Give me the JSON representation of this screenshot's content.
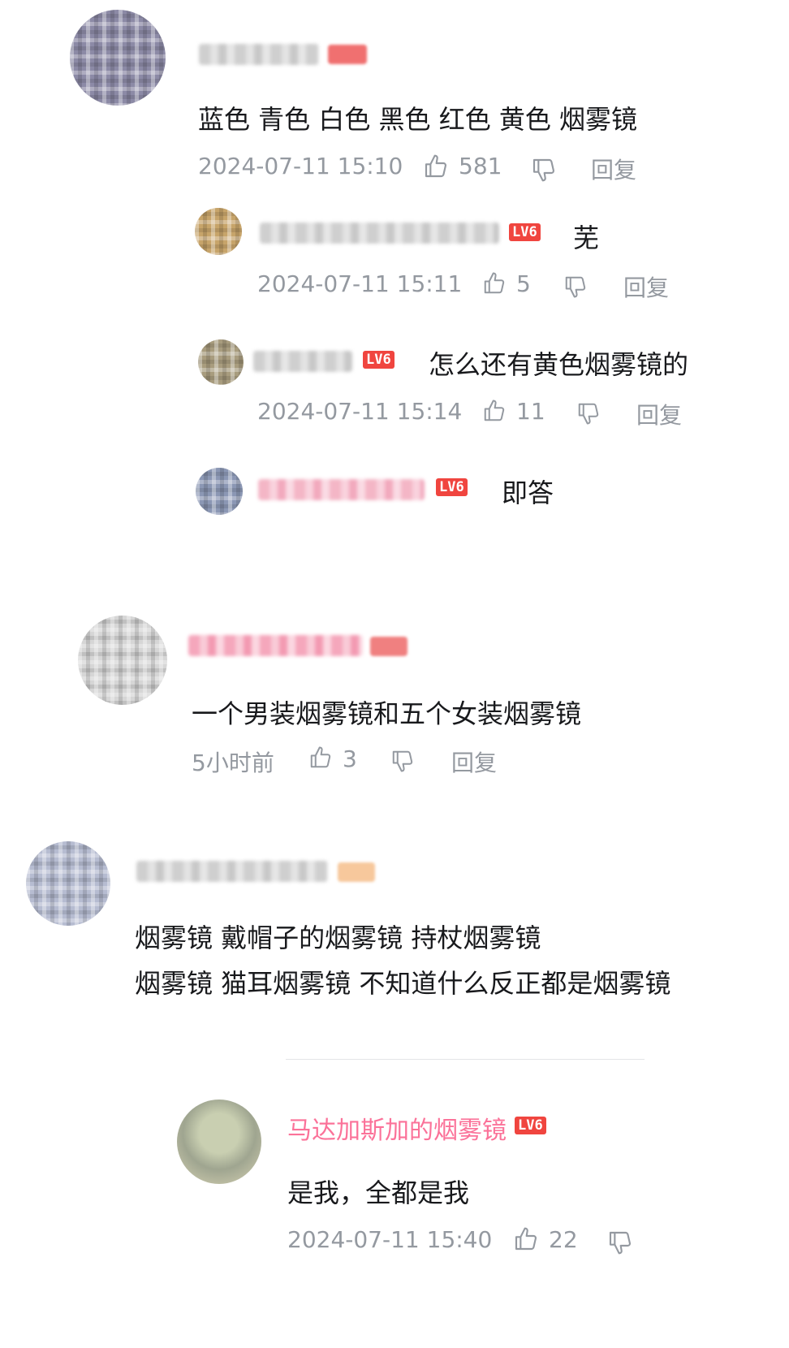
{
  "comments": [
    {
      "text": "蓝色 青色 白色 黑色 红色 黄色 烟雾镜",
      "time": "2024-07-11 15:10",
      "likes": "581",
      "reply": "回复",
      "replies": [
        {
          "level": "LV6",
          "text": "芜",
          "time": "2024-07-11 15:11",
          "likes": "5",
          "reply": "回复"
        },
        {
          "level": "LV6",
          "text": "怎么还有黄色烟雾镜的",
          "time": "2024-07-11 15:14",
          "likes": "11",
          "reply": "回复"
        },
        {
          "level": "LV6",
          "text": "即答"
        }
      ]
    },
    {
      "text": "一个男装烟雾镜和五个女装烟雾镜",
      "time": "5小时前",
      "likes": "3",
      "reply": "回复"
    },
    {
      "lines": [
        "烟雾镜 戴帽子的烟雾镜 持杖烟雾镜",
        "烟雾镜 猫耳烟雾镜 不知道什么反正都是烟雾镜"
      ]
    },
    {
      "username": "马达加斯加的烟雾镜",
      "level": "LV6",
      "text": "是我，全都是我",
      "time": "2024-07-11 15:40",
      "likes": "22"
    }
  ],
  "icons": {
    "like": "thumbs-up-icon",
    "dislike": "thumbs-down-icon"
  },
  "colors": {
    "level_badge": "#f0453f",
    "username_pink": "#fb7299",
    "meta_gray": "#9499a0"
  }
}
